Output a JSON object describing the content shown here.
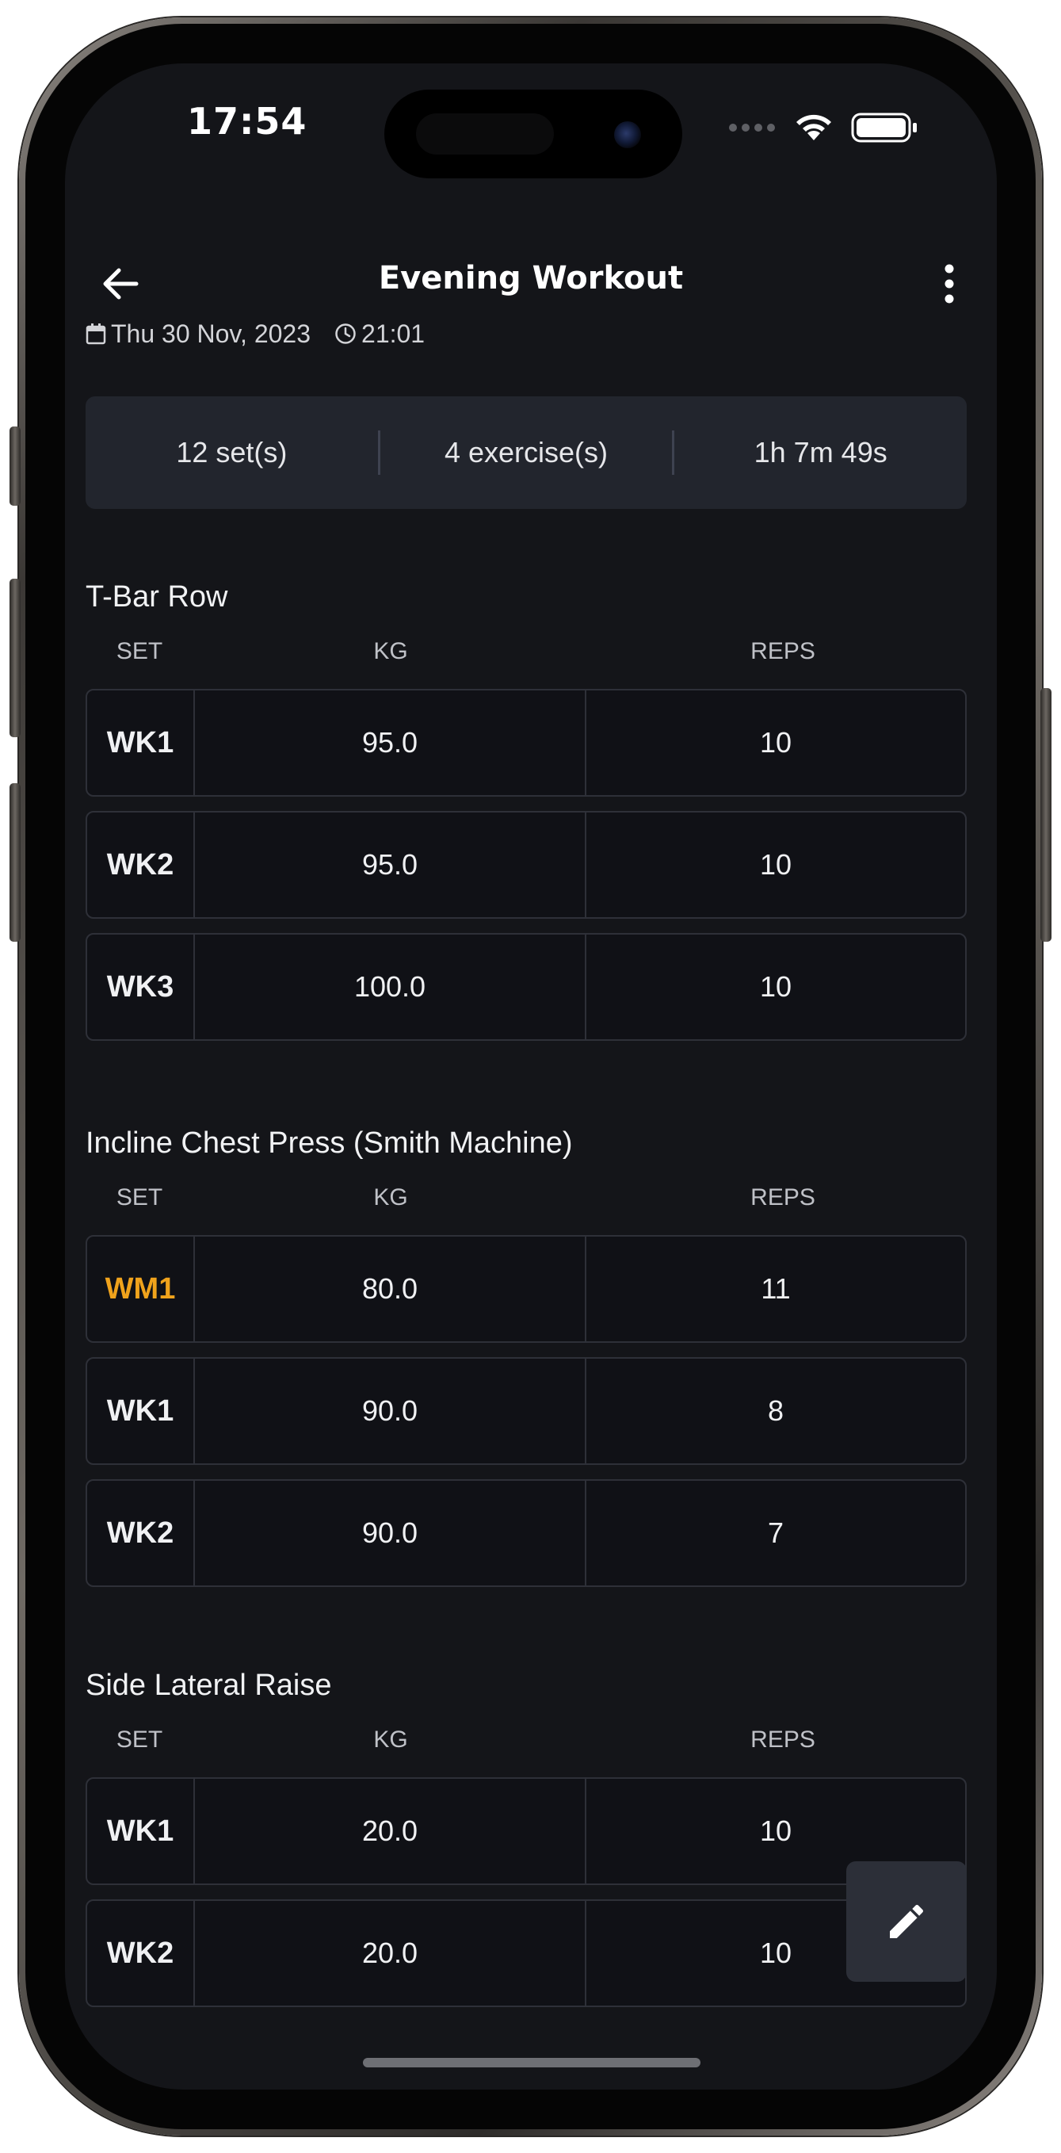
{
  "status_bar": {
    "time": "17:54"
  },
  "header": {
    "title": "Evening Workout",
    "back_icon": "arrow-left-icon",
    "menu_icon": "more-vertical-icon"
  },
  "meta": {
    "date": "Thu 30 Nov, 2023",
    "time": "21:01"
  },
  "stats": {
    "sets": "12 set(s)",
    "exercises": "4 exercise(s)",
    "duration": "1h 7m 49s"
  },
  "columns": {
    "set": "SET",
    "kg": "KG",
    "reps": "REPS"
  },
  "exercises": [
    {
      "name": "T-Bar Row",
      "sets": [
        {
          "set": "WK1",
          "kg": "95.0",
          "reps": "10"
        },
        {
          "set": "WK2",
          "kg": "95.0",
          "reps": "10"
        },
        {
          "set": "WK3",
          "kg": "100.0",
          "reps": "10"
        }
      ]
    },
    {
      "name": "Incline Chest Press (Smith Machine)",
      "sets": [
        {
          "set": "WM1",
          "kg": "80.0",
          "reps": "11"
        },
        {
          "set": "WK1",
          "kg": "90.0",
          "reps": "8"
        },
        {
          "set": "WK2",
          "kg": "90.0",
          "reps": "7"
        }
      ]
    },
    {
      "name": "Side Lateral Raise",
      "sets": [
        {
          "set": "WK1",
          "kg": "20.0",
          "reps": "10"
        },
        {
          "set": "WK2",
          "kg": "20.0",
          "reps": "10"
        }
      ]
    }
  ],
  "colors": {
    "background": "#141519",
    "card": "#22252d",
    "warmup_accent": "#f0a31c"
  },
  "fab": {
    "icon": "pencil-edit-icon"
  }
}
